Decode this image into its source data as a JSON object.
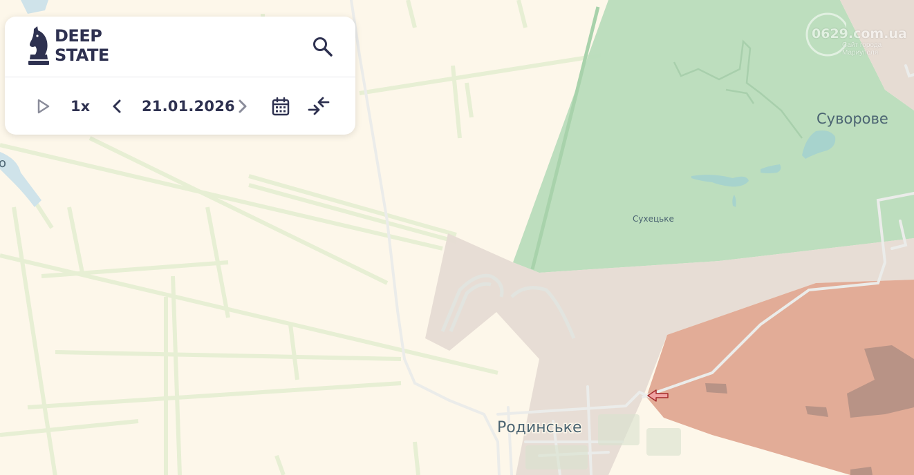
{
  "app": {
    "logo_line1": "DEEP",
    "logo_line2": "STATE"
  },
  "timeline": {
    "speed": "1x",
    "date": "21.01.2026"
  },
  "map": {
    "places": [
      {
        "name": "Суворове",
        "size": "large"
      },
      {
        "name": "Сухецьке",
        "size": "small"
      },
      {
        "name": "Родинське",
        "size": "large"
      },
      {
        "name": "о",
        "size": "large"
      }
    ],
    "colors": {
      "background": "#fdf7ea",
      "liberated_zone": "#b9dcbc",
      "contested_zone": "#e6dcd3",
      "occupied_zone": "#e0a892",
      "roads": "#eef0ee",
      "fields": "#e6efd3",
      "arrow": "#e16b6b"
    }
  },
  "watermark": {
    "domain": "0629.com.ua",
    "line1": "Сайт города",
    "line2": "Мариуполя"
  },
  "icons": [
    "logo-icon",
    "search-icon",
    "play-icon",
    "chevron-left-icon",
    "chevron-right-icon",
    "calendar-icon",
    "collapse-icon",
    "attack-arrow-icon"
  ]
}
